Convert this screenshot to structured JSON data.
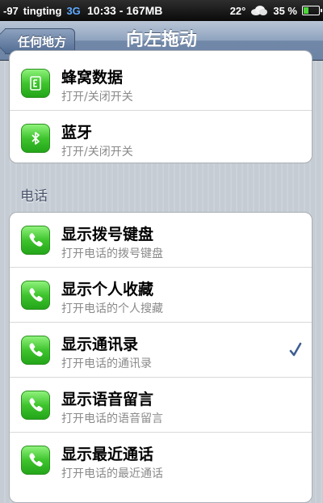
{
  "status_bar": {
    "signal": "-97",
    "carrier": "tingting",
    "network": "3G",
    "time_memory": "10:33 - 167MB",
    "temperature": "22°",
    "battery": "35 %",
    "battery_level": 0.35
  },
  "nav": {
    "back_label": "任何地方",
    "title": "向左拖动"
  },
  "group1": {
    "items": [
      {
        "title": "蜂窝数据",
        "subtitle": "打开/关闭开关",
        "icon": "cellular-data-icon"
      },
      {
        "title": "蓝牙",
        "subtitle": "打开/关闭开关",
        "icon": "bluetooth-icon"
      }
    ]
  },
  "section_header": "电话",
  "group2": {
    "items": [
      {
        "title": "显示拨号键盘",
        "subtitle": "打开电话的拨号键盘",
        "icon": "phone-icon",
        "checked": false
      },
      {
        "title": "显示个人收藏",
        "subtitle": "打开电话的个人搜藏",
        "icon": "phone-icon",
        "checked": false
      },
      {
        "title": "显示通讯录",
        "subtitle": "打开电话的通讯录",
        "icon": "phone-icon",
        "checked": true
      },
      {
        "title": "显示语音留言",
        "subtitle": "打开电话的语音留言",
        "icon": "phone-icon",
        "checked": false
      },
      {
        "title": "显示最近通话",
        "subtitle": "打开电话的最近通话",
        "icon": "phone-icon",
        "checked": false
      }
    ]
  },
  "colors": {
    "accent_check": "#3f5e90",
    "icon_green": "#3fc42e"
  }
}
